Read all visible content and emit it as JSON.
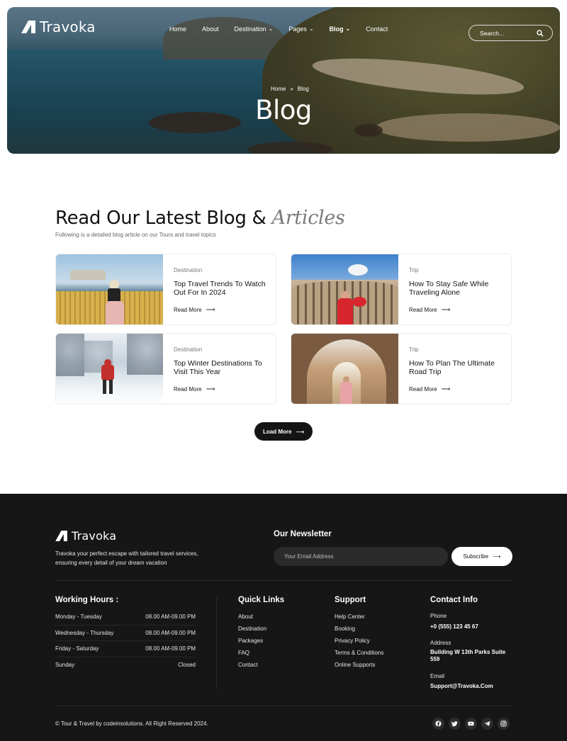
{
  "brand": {
    "name": "Travoka"
  },
  "nav": {
    "items": [
      {
        "label": "Home",
        "dropdown": false
      },
      {
        "label": "About",
        "dropdown": false
      },
      {
        "label": "Destination",
        "dropdown": true
      },
      {
        "label": "Pages",
        "dropdown": true
      },
      {
        "label": "Blog",
        "dropdown": true,
        "active": true
      },
      {
        "label": "Contact",
        "dropdown": false
      }
    ],
    "search_placeholder": "Search..."
  },
  "hero": {
    "breadcrumb": [
      "Home",
      "Blog"
    ],
    "title": "Blog"
  },
  "blog": {
    "heading": "Read Our Latest Blog &",
    "heading_accent": "Articles",
    "subtitle": "Following is a detailed blog article on our Tours and travel topics",
    "posts": [
      {
        "category": "Destination",
        "title": "Top Travel Trends To Watch Out For In 2024",
        "link": "Read More"
      },
      {
        "category": "Trip",
        "title": "How To Stay Safe While Traveling Alone",
        "link": "Read More"
      },
      {
        "category": "Destination",
        "title": "Top Winter Destinations To Visit This Year",
        "link": "Read More"
      },
      {
        "category": "Trip",
        "title": "How To Plan The Ultimate Road Trip",
        "link": "Read More"
      }
    ],
    "load_more": "Load More"
  },
  "footer": {
    "description": "Travoka your perfect escape with tailored travel services, ensuring every detail of your dream vacation",
    "newsletter": {
      "title": "Our Newsletter",
      "placeholder": "Your Email Address",
      "button": "Subscribe"
    },
    "hours": {
      "title": "Working Hours :",
      "rows": [
        {
          "day": "Monday - Tuesday",
          "time": "08.00 AM-09.00 PM"
        },
        {
          "day": "Wednesday - Thursday",
          "time": "08.00 AM-09.00 PM"
        },
        {
          "day": "Friday - Saturday",
          "time": "08.00 AM-09.00 PM"
        },
        {
          "day": "Sunday",
          "time": "Closed"
        }
      ]
    },
    "quick_links": {
      "title": "Quick Links",
      "items": [
        "About",
        "Destination",
        "Packages",
        "FAQ",
        "Contact"
      ]
    },
    "support": {
      "title": "Support",
      "items": [
        "Help Center",
        "Booking",
        "Privacy Policy",
        "Terms & Conditions",
        "Online Supports"
      ]
    },
    "contact": {
      "title": "Contact Info",
      "phone_label": "Phone",
      "phone": "+0 (555) 123 45 67",
      "address_label": "Address",
      "address": "Building W 13th Parks Suite 559",
      "email_label": "Email",
      "email": "Support@Travoka.Com"
    },
    "copyright": "© Tour & Travel by codeinsolutions. All Right Reserved 2024.",
    "socials": [
      "facebook-icon",
      "twitter-icon",
      "youtube-icon",
      "telegram-icon",
      "instagram-icon"
    ]
  }
}
